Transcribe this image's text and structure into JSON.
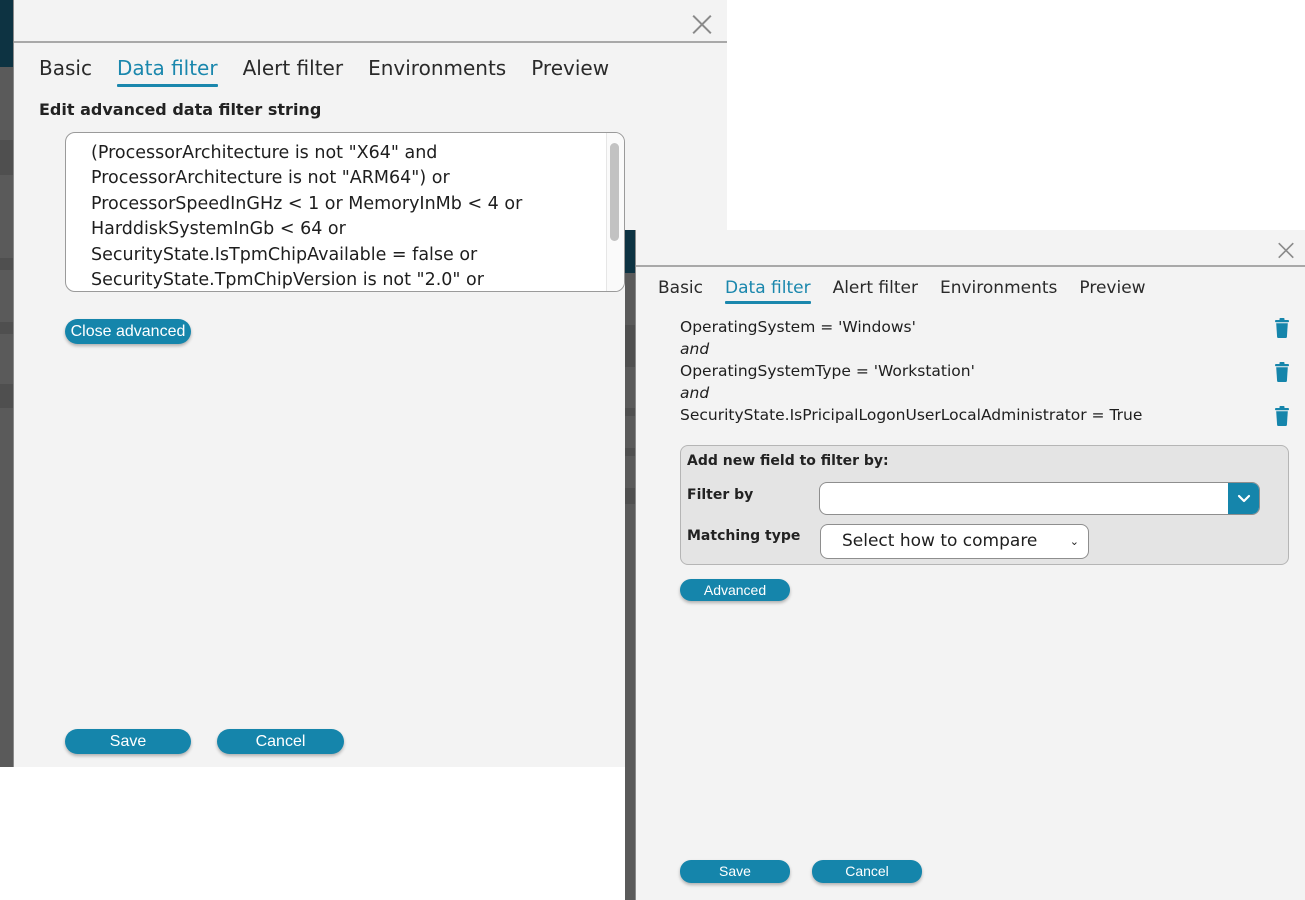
{
  "left_dialog": {
    "tabs": [
      {
        "label": "Basic",
        "active": false
      },
      {
        "label": "Data filter",
        "active": true
      },
      {
        "label": "Alert filter",
        "active": false
      },
      {
        "label": "Environments",
        "active": false
      },
      {
        "label": "Preview",
        "active": false
      }
    ],
    "section_label": "Edit advanced data filter string",
    "filter_string_lines": [
      "(ProcessorArchitecture is not \"X64\" and",
      "ProcessorArchitecture is not \"ARM64\") or",
      "ProcessorSpeedInGHz < 1 or MemoryInMb < 4 or",
      "HarddiskSystemInGb < 64 or",
      "SecurityState.IsTpmChipAvailable = false or",
      "SecurityState.TpmChipVersion is not \"2.0\" or"
    ],
    "close_advanced_label": "Close advanced",
    "save_label": "Save",
    "cancel_label": "Cancel"
  },
  "right_dialog": {
    "tabs": [
      {
        "label": "Basic",
        "active": false
      },
      {
        "label": "Data filter",
        "active": true
      },
      {
        "label": "Alert filter",
        "active": false
      },
      {
        "label": "Environments",
        "active": false
      },
      {
        "label": "Preview",
        "active": false
      }
    ],
    "conditions": [
      {
        "text": "OperatingSystem = 'Windows'"
      },
      {
        "text": "OperatingSystemType = 'Workstation'"
      },
      {
        "text": "SecurityState.IsPricipalLogonUserLocalAdministrator = True"
      }
    ],
    "connector": "and",
    "add_field": {
      "title": "Add new field to filter by:",
      "filter_by_label": "Filter by",
      "filter_by_value": "",
      "matching_type_label": "Matching type",
      "matching_type_value": "Select how to compare"
    },
    "advanced_label": "Advanced",
    "save_label": "Save",
    "cancel_label": "Cancel"
  },
  "icons": {
    "close": "close-icon",
    "delete": "trash-icon",
    "dropdown": "chevron-down-icon"
  },
  "colors": {
    "accent": "#1585ab",
    "active_tab": "#1a87ad",
    "sidebar_teal": "#0d3342",
    "sidebar_gray": "#5a5a5a",
    "panel_bg": "#f3f3f3"
  }
}
